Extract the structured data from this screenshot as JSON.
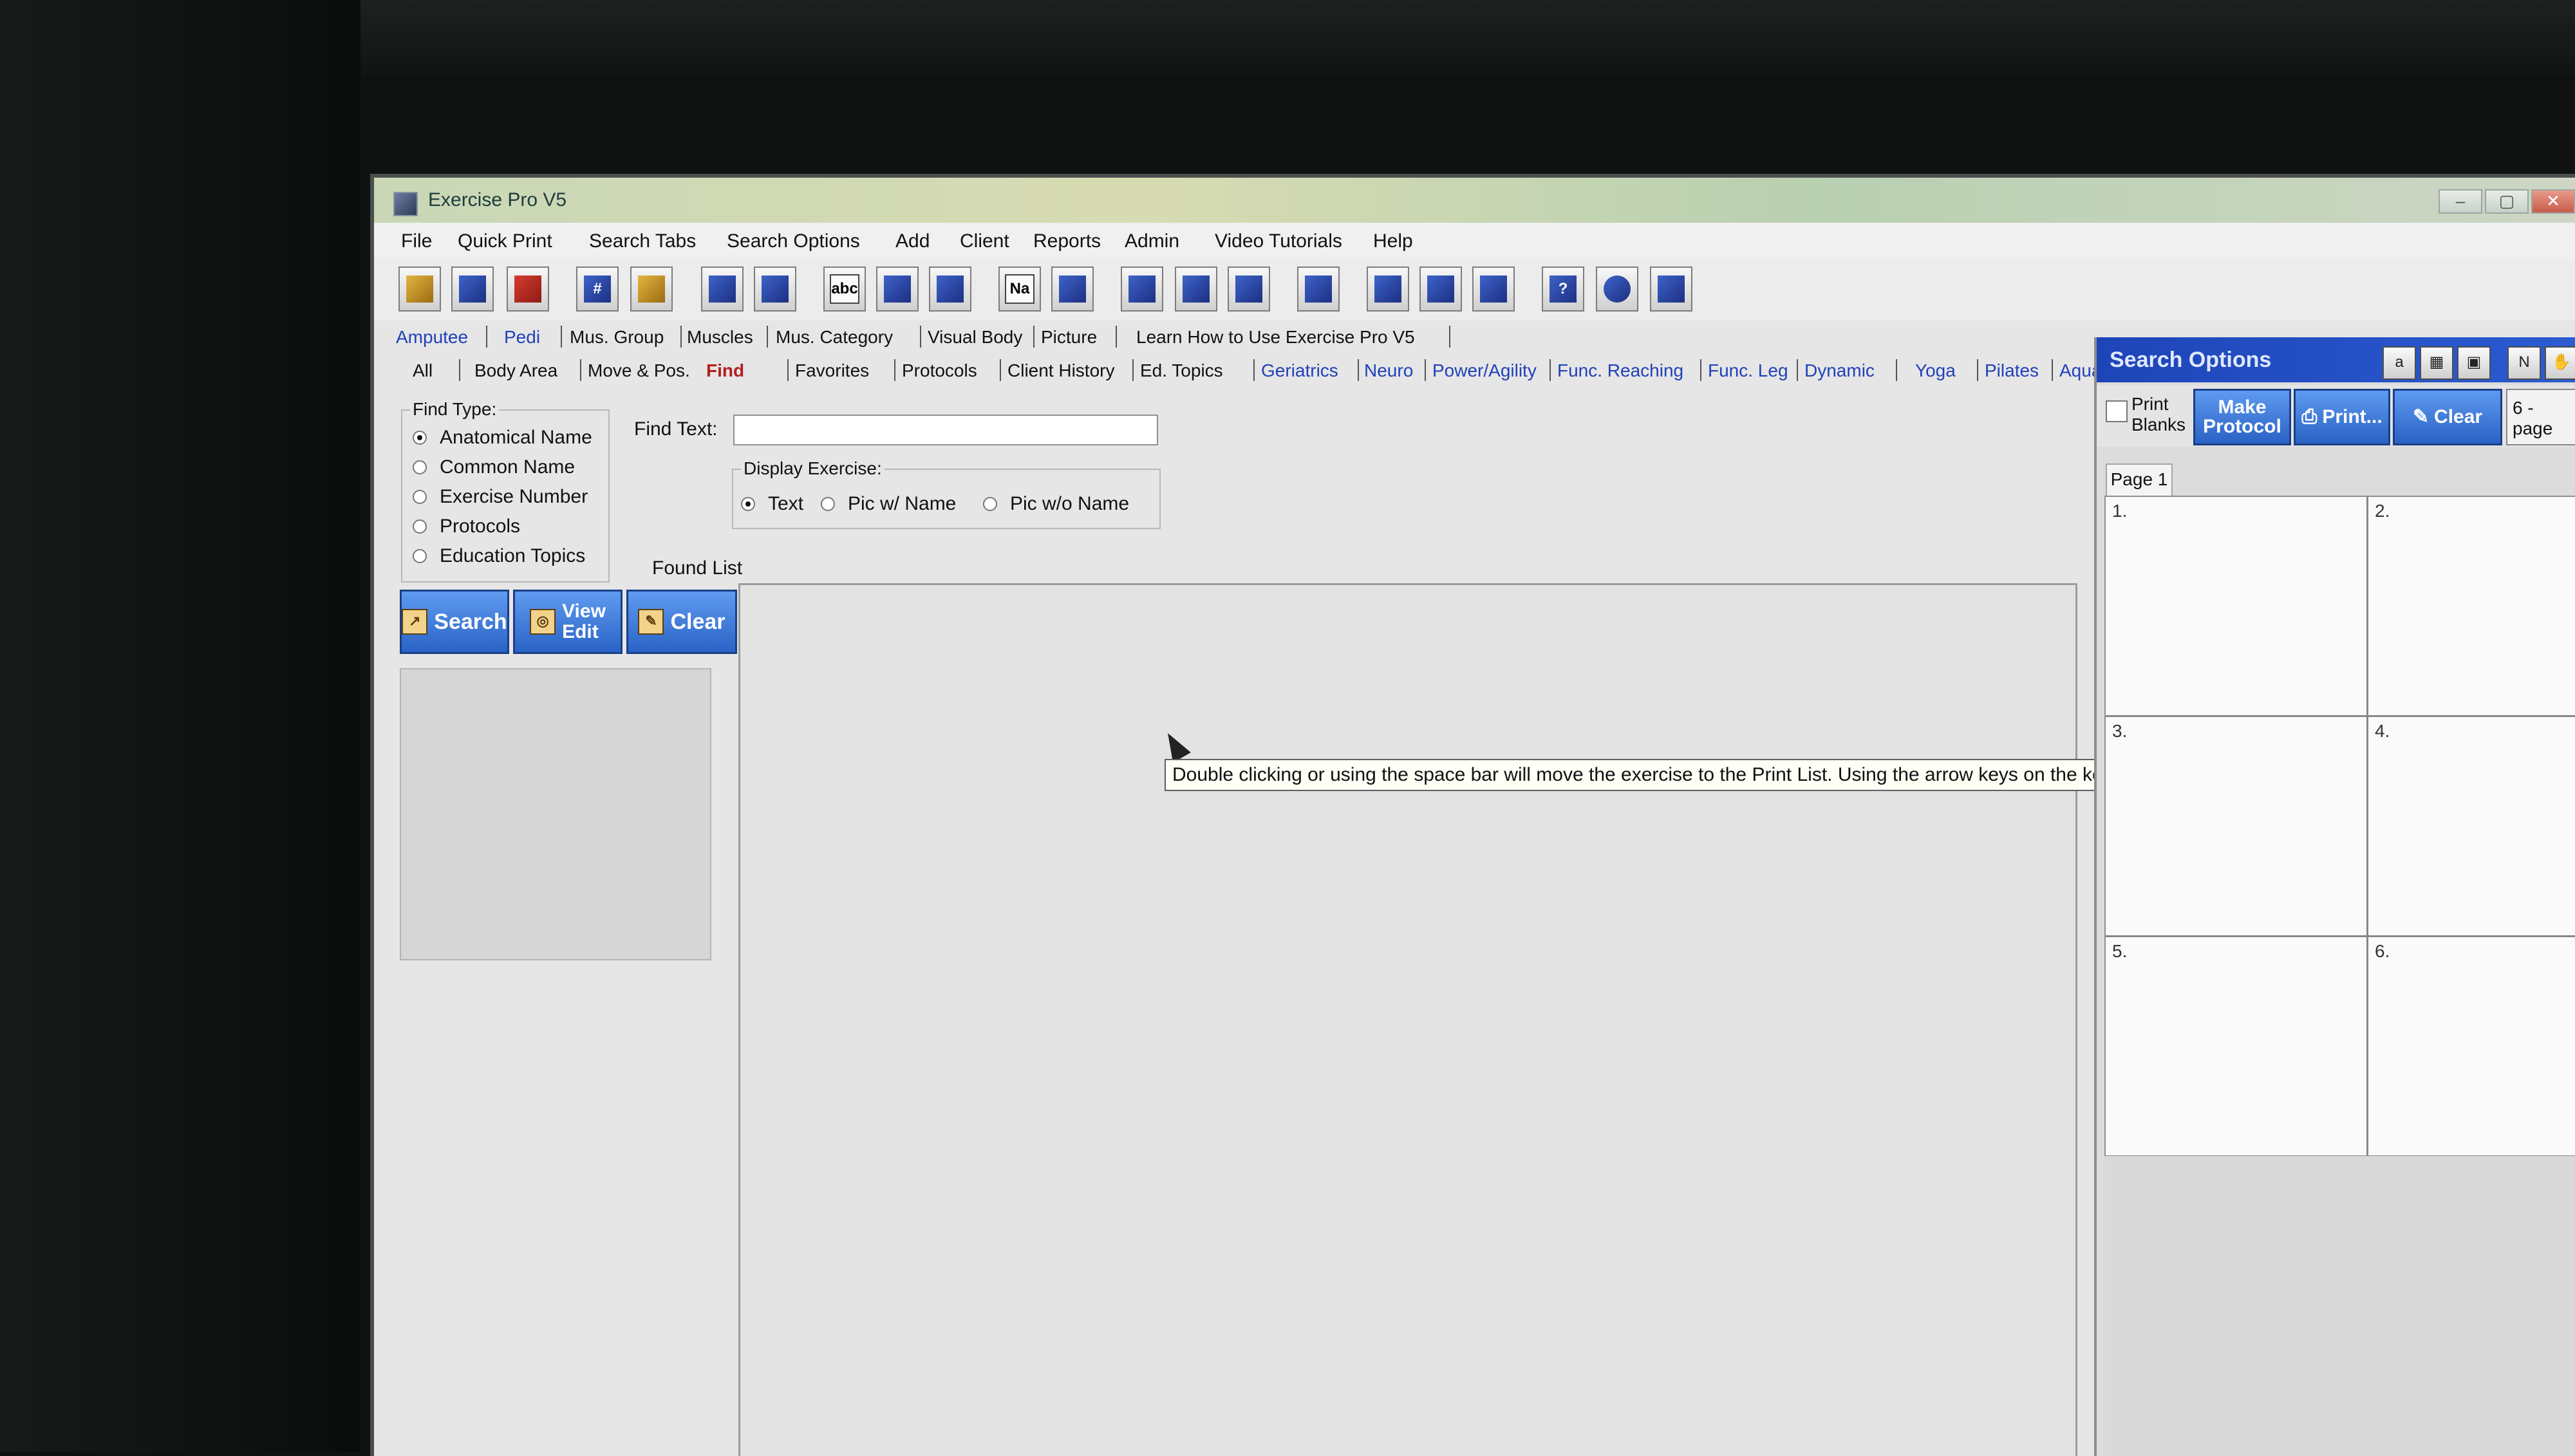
{
  "app": {
    "title": "Exercise Pro V5"
  },
  "window_controls": {
    "minimize": "–",
    "maximize": "▢",
    "close": "✕"
  },
  "menu": [
    "File",
    "Quick Print",
    "Search Tabs",
    "Search Options",
    "Add",
    "Client",
    "Reports",
    "Admin",
    "Video Tutorials",
    "Help"
  ],
  "toolbar": [
    "pencil-icon",
    "card-icon",
    "book-icon",
    "hash-icon",
    "scroll-icon",
    "grid-icon",
    "list-icon",
    "abc-icon",
    "thumbnail-icon",
    "image-icon",
    "na-icon",
    "hand-icon",
    "drawer-icon",
    "weight-icon",
    "frame-icon",
    "stretch-icon",
    "runner-icon",
    "mat-icon",
    "lift-icon",
    "help-icon",
    "globe-icon",
    "manual-icon"
  ],
  "toolbar_glyphs": {
    "hash": "#",
    "na": "Na",
    "help": "?",
    "abc": "abc"
  },
  "tabs_row1": [
    "Amputee",
    "Pedi",
    "Mus. Group",
    "Muscles",
    "Mus. Category",
    "Visual Body",
    "Picture",
    "Learn How to Use Exercise Pro V5"
  ],
  "tabs_row2": [
    "All",
    "Body Area",
    "Move & Pos.",
    "Find",
    "Favorites",
    "Protocols",
    "Client History",
    "Ed. Topics",
    "Geriatrics",
    "Neuro",
    "Power/Agility",
    "Func. Reaching",
    "Func. Leg",
    "Dynamic",
    "Yoga",
    "Pilates",
    "Aquatics"
  ],
  "find_type": {
    "legend": "Find Type:",
    "options": [
      "Anatomical Name",
      "Common Name",
      "Exercise Number",
      "Protocols",
      "Education Topics"
    ],
    "selected": "Anatomical Name"
  },
  "find_text": {
    "label": "Find Text:",
    "value": ""
  },
  "display_exercise": {
    "legend": "Display Exercise:",
    "options": [
      "Text",
      "Pic w/ Name",
      "Pic w/o Name"
    ],
    "selected": "Text"
  },
  "found_list": {
    "label": "Found List",
    "items": []
  },
  "actions": {
    "search": "Search",
    "view_edit_line1": "View",
    "view_edit_line2": "Edit",
    "clear": "Clear"
  },
  "tooltip": "Double clicking or using the space bar will move the exercise to the Print List. Using the arrow keys on the keyboard allows quick movement through the exercis",
  "search_options": {
    "title": "Search Options",
    "icons": [
      "abc-icon",
      "thumbnail-icon",
      "image-icon",
      "na-icon",
      "hand-icon"
    ],
    "print_blanks_line1": "Print",
    "print_blanks_line2": "Blanks",
    "make_protocol_line1": "Make",
    "make_protocol_line2": "Protocol",
    "print": "Print...",
    "clear": "Clear",
    "page_layout": "6 - page",
    "page_tab": "Page 1",
    "slots": [
      "1.",
      "2.",
      "3.",
      "4.",
      "5.",
      "6."
    ]
  },
  "colors": {
    "tab_blue": "#2041b8",
    "tab_active": "#b21f1f",
    "button_blue": "#2a63c6",
    "title_blue": "#1e45b8"
  }
}
